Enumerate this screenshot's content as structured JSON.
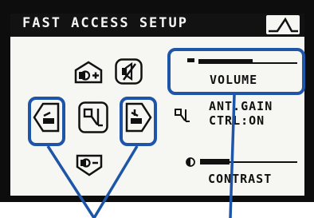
{
  "screen": {
    "title": "FAST ACCESS SETUP",
    "title_icon": "waveform-peak-icon"
  },
  "buttons": [
    {
      "name": "volume-up-button",
      "icon": "speaker-plus-icon"
    },
    {
      "name": "mute-button",
      "icon": "speaker-mute-icon"
    },
    {
      "name": "previous-button",
      "icon": "arrow-left-icon"
    },
    {
      "name": "auto-gain-button",
      "icon": "gain-icon"
    },
    {
      "name": "next-button",
      "icon": "arrow-right-icon"
    },
    {
      "name": "volume-down-button",
      "icon": "speaker-minus-icon"
    }
  ],
  "volume": {
    "label": "VOLUME",
    "level": 0.55
  },
  "ant_gain": {
    "line1": "ANT.GAIN",
    "line2": "CTRL:ON"
  },
  "contrast": {
    "label": "CONTRAST",
    "level": 0.3
  },
  "colors": {
    "callout": "#1f55a8",
    "lcd_background": "#f6f6f2",
    "lcd_ink": "#111111"
  }
}
